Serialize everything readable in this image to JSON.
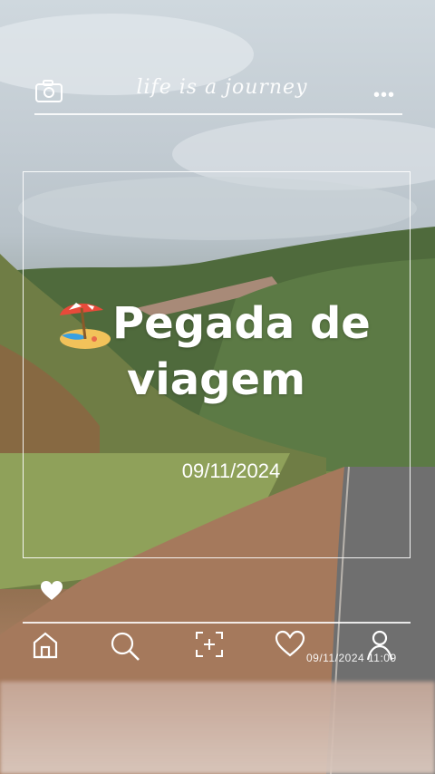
{
  "header": {
    "tagline": "life is a journey",
    "menu_dots": "•••"
  },
  "post": {
    "title_line1": "Pegada de",
    "title_line2": "viagem",
    "date": "09/11/2024"
  },
  "footer": {
    "timestamp": "09/11/2024  11:09"
  },
  "colors": {
    "overlay": "#ffffff",
    "sky": "#c7d0d6",
    "hill": "#5d7444",
    "road_dirt": "#a07a5c"
  },
  "icons": [
    "camera-icon",
    "more-dots-icon",
    "beach-umbrella-icon",
    "heart-icon",
    "home-icon",
    "search-icon",
    "add-photo-icon",
    "heart-outline-icon",
    "profile-icon"
  ]
}
